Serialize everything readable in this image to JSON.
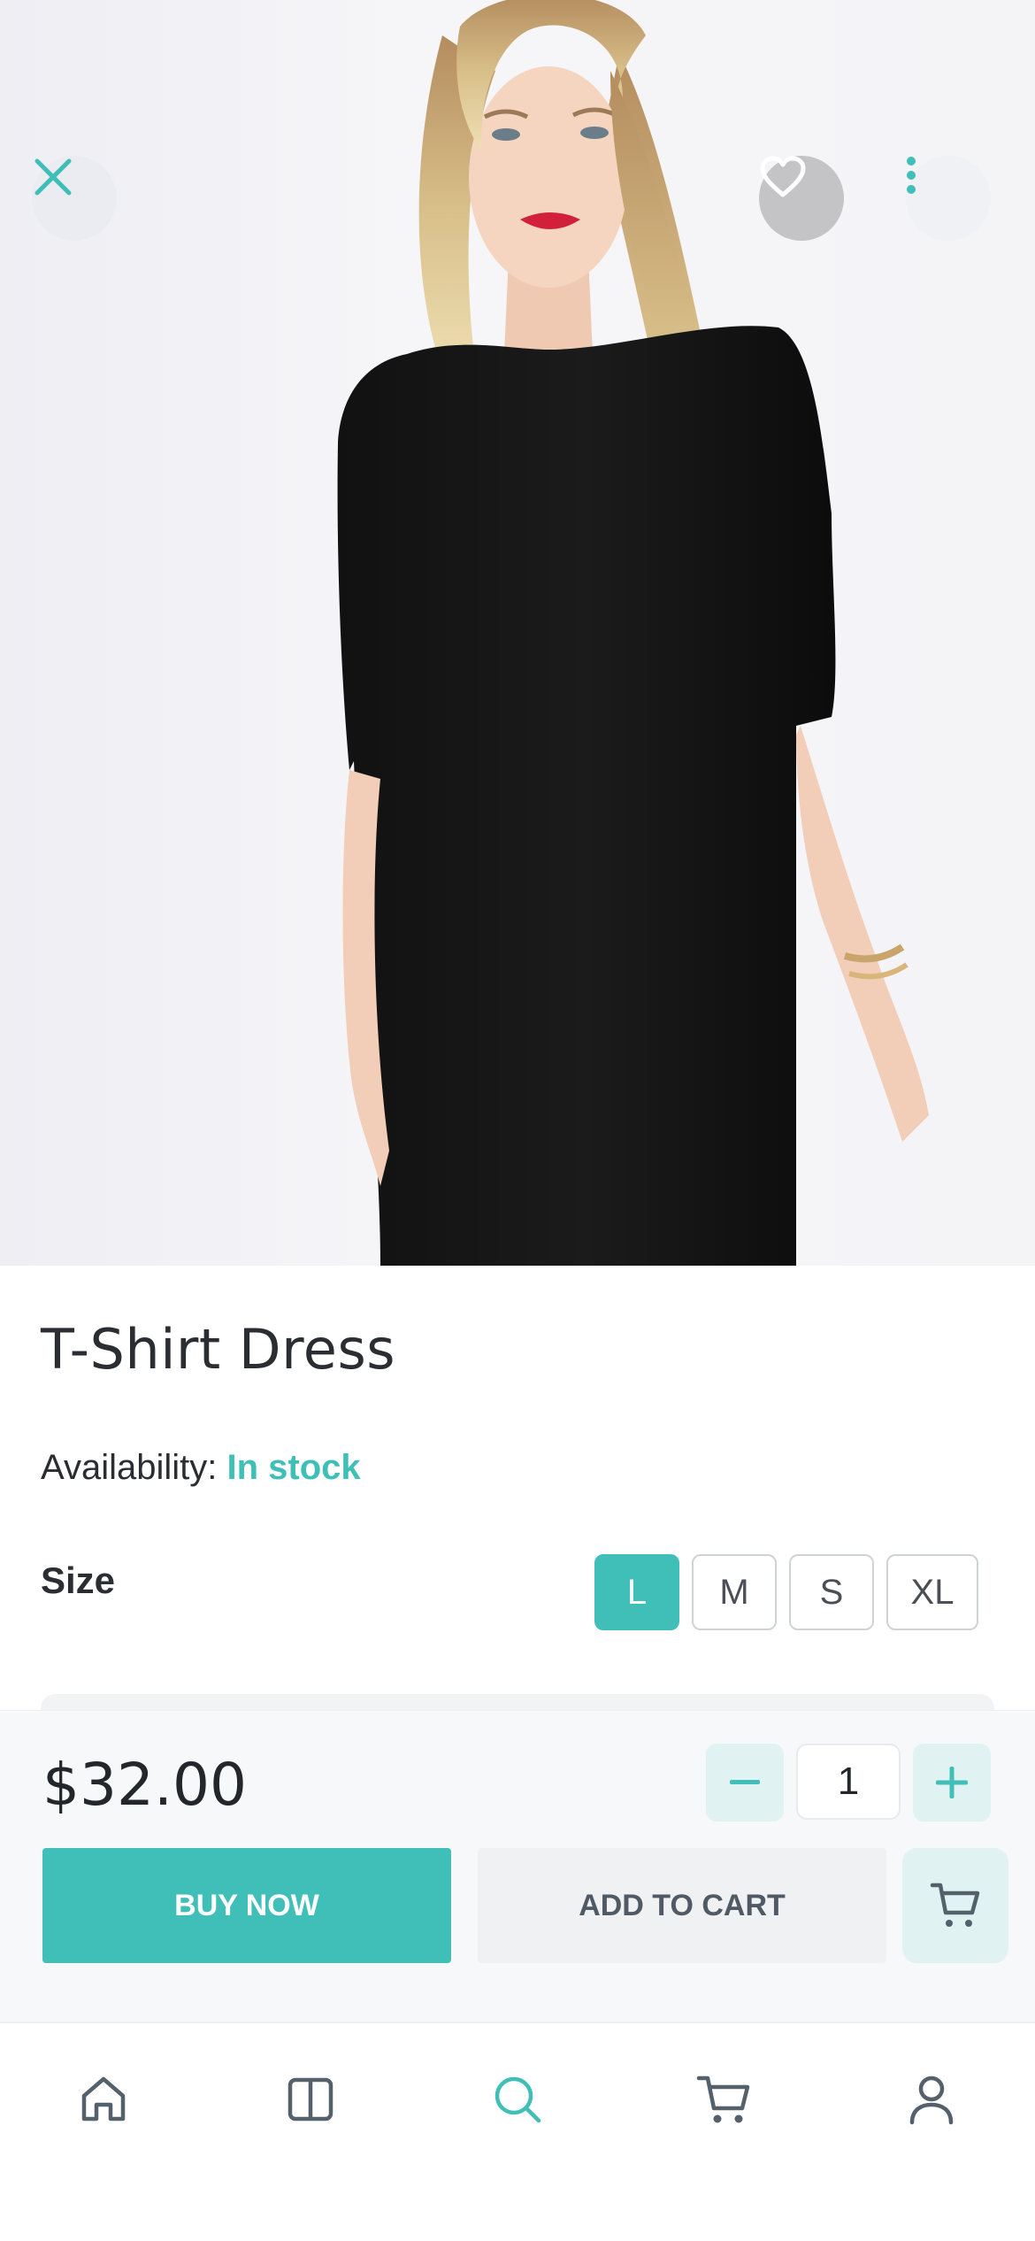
{
  "product": {
    "title": "T-Shirt Dress",
    "availability_label": "Availability:",
    "availability_value": "In stock",
    "size_label": "Size",
    "sizes": [
      {
        "label": "L",
        "selected": true
      },
      {
        "label": "M",
        "selected": false
      },
      {
        "label": "S",
        "selected": false
      },
      {
        "label": "XL",
        "selected": false
      }
    ],
    "price": "$32.00",
    "quantity": "1"
  },
  "actions": {
    "buy_now": "BUY NOW",
    "add_to_cart": "ADD TO CART"
  },
  "icons": {
    "close": "close-icon",
    "favorite": "heart-icon",
    "more": "more-vertical-icon",
    "minus": "minus-icon",
    "plus": "plus-icon",
    "cart": "cart-icon"
  },
  "bottom_nav": [
    {
      "icon": "home-icon",
      "active": false
    },
    {
      "icon": "catalog-icon",
      "active": false
    },
    {
      "icon": "search-icon",
      "active": true
    },
    {
      "icon": "cart-icon",
      "active": false
    },
    {
      "icon": "profile-icon",
      "active": false
    }
  ],
  "colors": {
    "accent": "#40bfb8",
    "accent_light": "#e0f3f2",
    "text": "#2a2d31",
    "nav_icon": "#54616b"
  }
}
